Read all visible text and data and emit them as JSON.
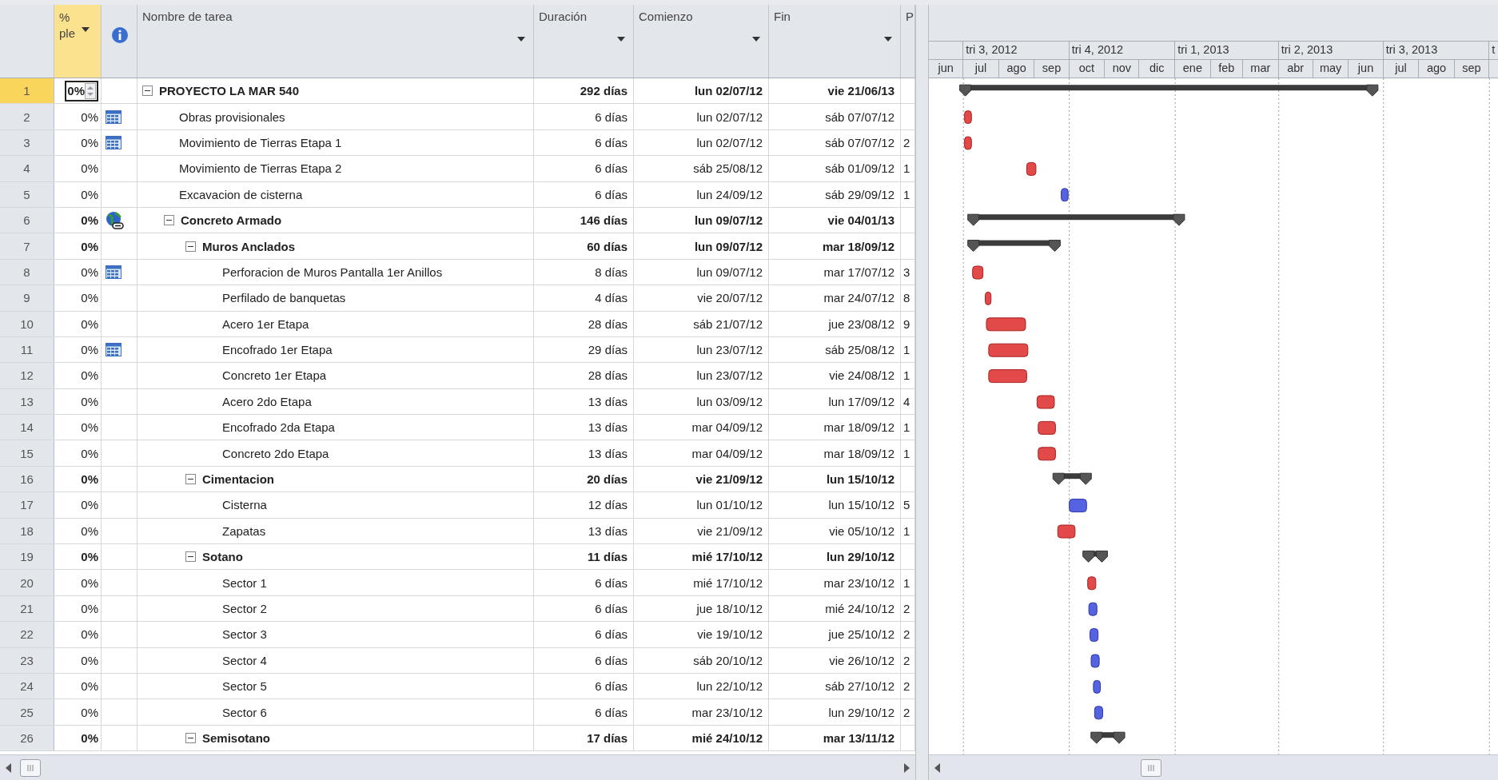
{
  "columns": [
    {
      "kind": "text",
      "label": "% ple",
      "selected": true,
      "filter_arrow": true
    },
    {
      "kind": "info",
      "selected": false,
      "filter_arrow": false
    },
    {
      "kind": "text",
      "label": "Nombre de tarea",
      "selected": false,
      "filter_arrow": true
    },
    {
      "kind": "text",
      "label": "Duración",
      "selected": false,
      "filter_arrow": true
    },
    {
      "kind": "text",
      "label": "Comienzo",
      "selected": false,
      "filter_arrow": true
    },
    {
      "kind": "text",
      "label": "Fin",
      "selected": false,
      "filter_arrow": true
    },
    {
      "kind": "text",
      "label": "P",
      "selected": false,
      "filter_arrow": false
    }
  ],
  "timescale": {
    "quarters": [
      "tri 3, 2012",
      "tri 4, 2012",
      "tri 1, 2013",
      "tri 2, 2013",
      "tri 3, 2013",
      "t"
    ],
    "months": [
      "jun",
      "jul",
      "ago",
      "sep",
      "oct",
      "nov",
      "dic",
      "ene",
      "feb",
      "mar",
      "abr",
      "may",
      "jun",
      "jul",
      "ago",
      "sep"
    ]
  },
  "tasks": [
    {
      "number": "1",
      "kind": "summary",
      "expanded": true,
      "selected": true,
      "percent": "0%",
      "name": "PROYECTO LA MAR 540",
      "duration": "292 días",
      "start": "lun 02/07/12",
      "finish": "vie 21/06/13",
      "children": [
        {
          "number": "2",
          "kind": "task",
          "selected": false,
          "critical": true,
          "indicator": {
            "kind": "calendar"
          },
          "percent": "0%",
          "name": "Obras provisionales",
          "duration": "6 días",
          "start": "lun 02/07/12",
          "finish": "sáb 07/07/12"
        },
        {
          "number": "3",
          "kind": "task",
          "selected": false,
          "critical": true,
          "indicator": {
            "kind": "calendar"
          },
          "percent": "0%",
          "name": "Movimiento de Tierras Etapa 1",
          "duration": "6 días",
          "start": "lun 02/07/12",
          "finish": "sáb 07/07/12",
          "predecessors": "2"
        },
        {
          "number": "4",
          "kind": "task",
          "selected": false,
          "critical": true,
          "percent": "0%",
          "name": "Movimiento de Tierras Etapa 2",
          "duration": "6 días",
          "start": "sáb 25/08/12",
          "finish": "sáb 01/09/12",
          "predecessors": "1"
        },
        {
          "number": "5",
          "kind": "task",
          "selected": false,
          "critical": false,
          "percent": "0%",
          "name": "Excavacion de cisterna",
          "duration": "6 días",
          "start": "lun 24/09/12",
          "finish": "sáb 29/09/12",
          "predecessors": "1"
        },
        {
          "number": "6",
          "kind": "summary",
          "expanded": true,
          "selected": false,
          "indicator": {
            "kind": "globe"
          },
          "percent": "0%",
          "name": "Concreto Armado",
          "duration": "146 días",
          "start": "lun 09/07/12",
          "finish": "vie 04/01/13",
          "children": [
            {
              "number": "7",
              "kind": "summary",
              "expanded": true,
              "selected": false,
              "percent": "0%",
              "name": "Muros Anclados",
              "duration": "60 días",
              "start": "lun 09/07/12",
              "finish": "mar 18/09/12",
              "children": [
                {
                  "number": "8",
                  "kind": "task",
                  "selected": false,
                  "critical": true,
                  "indicator": {
                    "kind": "calendar"
                  },
                  "percent": "0%",
                  "name": "Perforacion de Muros Pantalla 1er Anillos",
                  "duration": "8 días",
                  "start": "lun 09/07/12",
                  "finish": "mar 17/07/12",
                  "predecessors": "3"
                },
                {
                  "number": "9",
                  "kind": "task",
                  "selected": false,
                  "critical": true,
                  "percent": "0%",
                  "name": "Perfilado de banquetas",
                  "duration": "4 días",
                  "start": "vie 20/07/12",
                  "finish": "mar 24/07/12",
                  "predecessors": "8"
                },
                {
                  "number": "10",
                  "kind": "task",
                  "selected": false,
                  "critical": true,
                  "percent": "0%",
                  "name": "Acero 1er Etapa",
                  "duration": "28 días",
                  "start": "sáb 21/07/12",
                  "finish": "jue 23/08/12",
                  "predecessors": "9"
                },
                {
                  "number": "11",
                  "kind": "task",
                  "selected": false,
                  "critical": true,
                  "indicator": {
                    "kind": "calendar"
                  },
                  "percent": "0%",
                  "name": "Encofrado 1er Etapa",
                  "duration": "29 días",
                  "start": "lun 23/07/12",
                  "finish": "sáb 25/08/12",
                  "predecessors": "1"
                },
                {
                  "number": "12",
                  "kind": "task",
                  "selected": false,
                  "critical": true,
                  "percent": "0%",
                  "name": "Concreto 1er Etapa",
                  "duration": "28 días",
                  "start": "lun 23/07/12",
                  "finish": "vie 24/08/12",
                  "predecessors": "1"
                },
                {
                  "number": "13",
                  "kind": "task",
                  "selected": false,
                  "critical": true,
                  "percent": "0%",
                  "name": "Acero 2do Etapa",
                  "duration": "13 días",
                  "start": "lun 03/09/12",
                  "finish": "lun 17/09/12",
                  "predecessors": "4"
                },
                {
                  "number": "14",
                  "kind": "task",
                  "selected": false,
                  "critical": true,
                  "percent": "0%",
                  "name": "Encofrado 2da Etapa",
                  "duration": "13 días",
                  "start": "mar 04/09/12",
                  "finish": "mar 18/09/12",
                  "predecessors": "1"
                },
                {
                  "number": "15",
                  "kind": "task",
                  "selected": false,
                  "critical": true,
                  "percent": "0%",
                  "name": "Concreto 2do Etapa",
                  "duration": "13 días",
                  "start": "mar 04/09/12",
                  "finish": "mar 18/09/12",
                  "predecessors": "1"
                }
              ]
            },
            {
              "number": "16",
              "kind": "summary",
              "expanded": true,
              "selected": false,
              "percent": "0%",
              "name": "Cimentacion",
              "duration": "20 días",
              "start": "vie 21/09/12",
              "finish": "lun 15/10/12",
              "children": [
                {
                  "number": "17",
                  "kind": "task",
                  "selected": false,
                  "critical": false,
                  "percent": "0%",
                  "name": "Cisterna",
                  "duration": "12 días",
                  "start": "lun 01/10/12",
                  "finish": "lun 15/10/12",
                  "predecessors": "5"
                },
                {
                  "number": "18",
                  "kind": "task",
                  "selected": false,
                  "critical": true,
                  "percent": "0%",
                  "name": "Zapatas",
                  "duration": "13 días",
                  "start": "vie 21/09/12",
                  "finish": "vie 05/10/12",
                  "predecessors": "1"
                }
              ]
            },
            {
              "number": "19",
              "kind": "summary",
              "expanded": true,
              "selected": false,
              "percent": "0%",
              "name": "Sotano",
              "duration": "11 días",
              "start": "mié 17/10/12",
              "finish": "lun 29/10/12",
              "children": [
                {
                  "number": "20",
                  "kind": "task",
                  "selected": false,
                  "critical": true,
                  "percent": "0%",
                  "name": "Sector 1",
                  "duration": "6 días",
                  "start": "mié 17/10/12",
                  "finish": "mar 23/10/12",
                  "predecessors": "1"
                },
                {
                  "number": "21",
                  "kind": "task",
                  "selected": false,
                  "critical": false,
                  "percent": "0%",
                  "name": "Sector 2",
                  "duration": "6 días",
                  "start": "jue 18/10/12",
                  "finish": "mié 24/10/12",
                  "predecessors": "2"
                },
                {
                  "number": "22",
                  "kind": "task",
                  "selected": false,
                  "critical": false,
                  "percent": "0%",
                  "name": "Sector 3",
                  "duration": "6 días",
                  "start": "vie 19/10/12",
                  "finish": "jue 25/10/12",
                  "predecessors": "2"
                },
                {
                  "number": "23",
                  "kind": "task",
                  "selected": false,
                  "critical": false,
                  "percent": "0%",
                  "name": "Sector 4",
                  "duration": "6 días",
                  "start": "sáb 20/10/12",
                  "finish": "vie 26/10/12",
                  "predecessors": "2"
                },
                {
                  "number": "24",
                  "kind": "task",
                  "selected": false,
                  "critical": false,
                  "percent": "0%",
                  "name": "Sector 5",
                  "duration": "6 días",
                  "start": "lun 22/10/12",
                  "finish": "sáb 27/10/12",
                  "predecessors": "2"
                },
                {
                  "number": "25",
                  "kind": "task",
                  "selected": false,
                  "critical": false,
                  "percent": "0%",
                  "name": "Sector 6",
                  "duration": "6 días",
                  "start": "mar 23/10/12",
                  "finish": "lun 29/10/12",
                  "predecessors": "2"
                }
              ]
            },
            {
              "number": "26",
              "kind": "summary",
              "expanded": true,
              "selected": false,
              "percent": "0%",
              "name": "Semisotano",
              "duration": "17 días",
              "start": "mié 24/10/12",
              "finish": "mar 13/11/12"
            }
          ]
        }
      ]
    }
  ]
}
